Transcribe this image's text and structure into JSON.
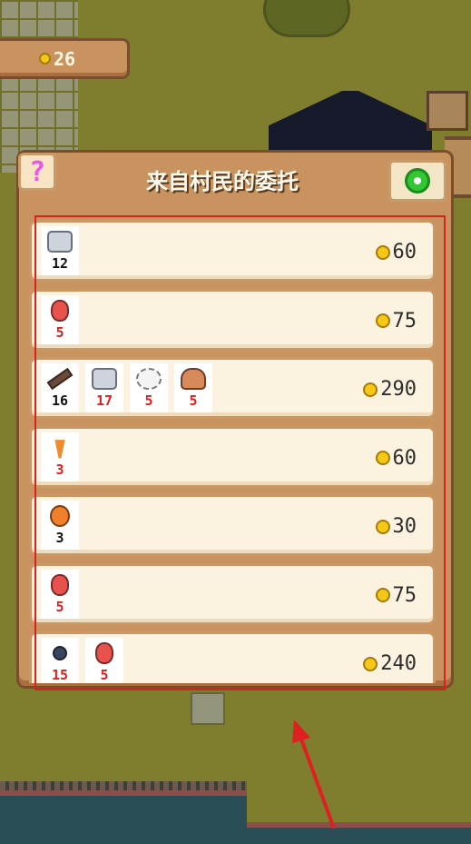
{
  "hud": {
    "coins": "26"
  },
  "panel": {
    "help_label": "?",
    "title": "来自村民的委托",
    "refresh_icon": "refresh-icon"
  },
  "orders": [
    {
      "items": [
        {
          "icon": "stone",
          "qty": "12",
          "enough": true
        }
      ],
      "reward": "60"
    },
    {
      "items": [
        {
          "icon": "berry",
          "qty": "5",
          "enough": false
        }
      ],
      "reward": "75"
    },
    {
      "items": [
        {
          "icon": "log",
          "qty": "16",
          "enough": true
        },
        {
          "icon": "stone",
          "qty": "17",
          "enough": false
        },
        {
          "icon": "cotton",
          "qty": "5",
          "enough": false
        },
        {
          "icon": "mushroom",
          "qty": "5",
          "enough": false
        }
      ],
      "reward": "290"
    },
    {
      "items": [
        {
          "icon": "carrot",
          "qty": "3",
          "enough": false
        }
      ],
      "reward": "60"
    },
    {
      "items": [
        {
          "icon": "orange",
          "qty": "3",
          "enough": true
        }
      ],
      "reward": "30"
    },
    {
      "items": [
        {
          "icon": "berry",
          "qty": "5",
          "enough": false
        }
      ],
      "reward": "75"
    },
    {
      "items": [
        {
          "icon": "blueberry",
          "qty": "15",
          "enough": false
        },
        {
          "icon": "berry",
          "qty": "5",
          "enough": false
        }
      ],
      "reward": "240"
    }
  ],
  "colors": {
    "short_qty": "#e01d1d",
    "ok_qty": "#111111",
    "panel": "#c8935e",
    "annotation": "#e02020"
  }
}
